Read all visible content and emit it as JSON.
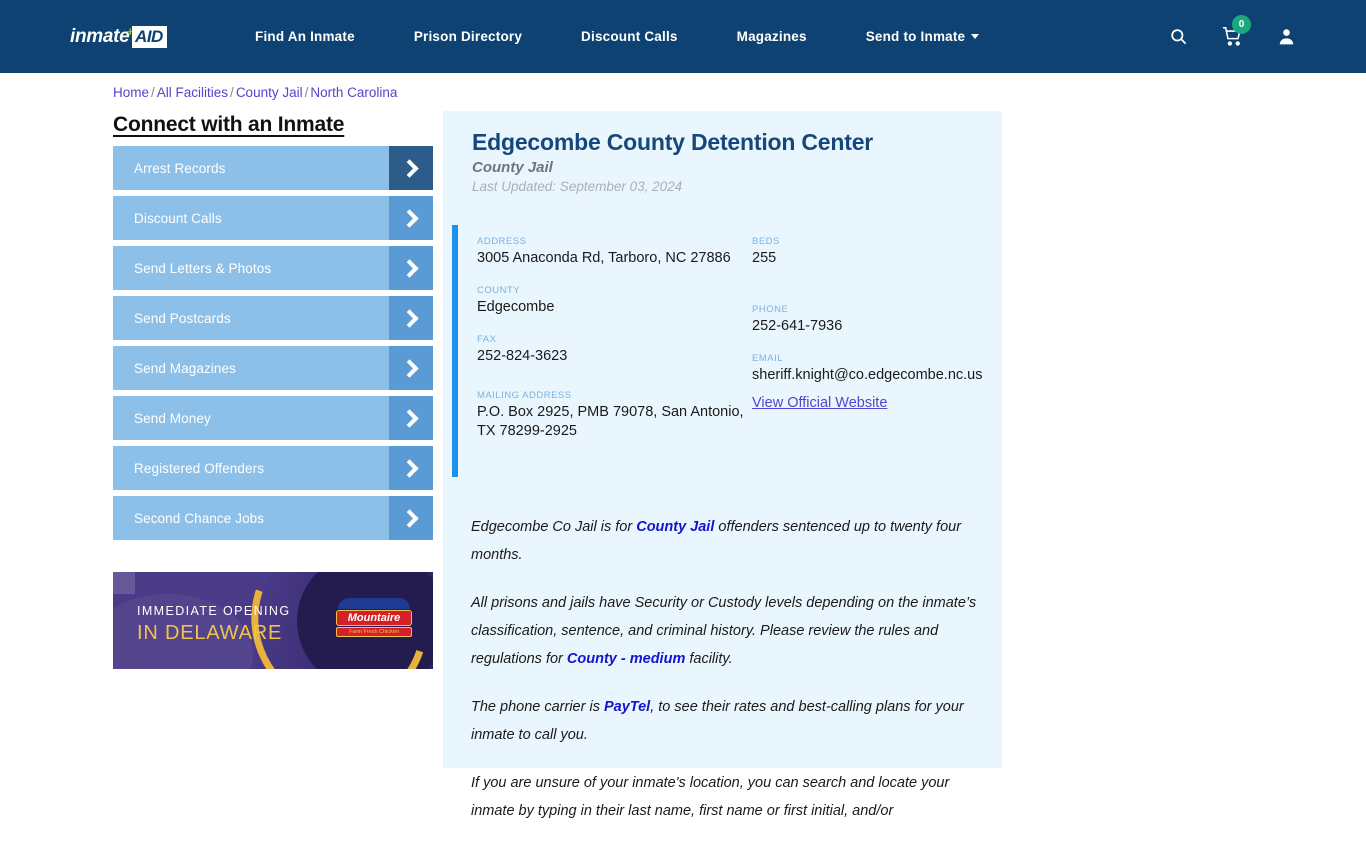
{
  "header": {
    "logo": {
      "word": "inmate",
      "cross": "+",
      "aid": "AID"
    },
    "nav": [
      {
        "label": "Find An Inmate",
        "dropdown": false
      },
      {
        "label": "Prison Directory",
        "dropdown": false
      },
      {
        "label": "Discount Calls",
        "dropdown": false
      },
      {
        "label": "Magazines",
        "dropdown": false
      },
      {
        "label": "Send to Inmate",
        "dropdown": true
      }
    ],
    "icons": {
      "search": "search-icon",
      "cart": "cart-icon",
      "cart_count": "0",
      "account": "user-icon"
    }
  },
  "breadcrumb": [
    {
      "label": "Home"
    },
    {
      "label": "All Facilities"
    },
    {
      "label": "County Jail"
    },
    {
      "label": "North Carolina"
    }
  ],
  "sidebar": {
    "title": "Connect with an Inmate",
    "items": [
      {
        "label": "Arrest Records",
        "active": true
      },
      {
        "label": "Discount Calls",
        "active": false
      },
      {
        "label": "Send Letters & Photos",
        "active": false
      },
      {
        "label": "Send Postcards",
        "active": false
      },
      {
        "label": "Send Magazines",
        "active": false
      },
      {
        "label": "Send Money",
        "active": false
      },
      {
        "label": "Registered Offenders",
        "active": false
      },
      {
        "label": "Second Chance Jobs",
        "active": false
      }
    ],
    "ad": {
      "line1": "IMMEDIATE OPENING",
      "line2": "IN DELAWARE",
      "logo_main": "Mountaire",
      "logo_sub": "Farm Fresh Chicken"
    }
  },
  "facility": {
    "name": "Edgecombe County Detention Center",
    "type": "County Jail",
    "last_updated": "Last Updated: September 03, 2024",
    "info_left": [
      {
        "label": "ADDRESS",
        "value": "3005 Anaconda Rd, Tarboro, NC 27886"
      },
      {
        "label": "COUNTY",
        "value": "Edgecombe"
      },
      {
        "label": "FAX",
        "value": "252-824-3623"
      },
      {
        "label": "MAILING ADDRESS",
        "value": "P.O. Box 2925, PMB 79078, San Antonio, TX 78299-2925"
      }
    ],
    "info_right": [
      {
        "label": "BEDS",
        "value": "255"
      },
      {
        "label": "PHONE",
        "value": "252-641-7936"
      },
      {
        "label": "EMAIL",
        "value": "sheriff.knight@co.edgecombe.nc.us"
      }
    ],
    "website_link": "View Official Website"
  },
  "body": {
    "p1_a": "Edgecombe Co Jail is for ",
    "p1_b": "County Jail",
    "p1_c": " offenders sentenced up to twenty four months.",
    "p2_a": "All prisons and jails have Security or Custody levels depending on the inmate’s classification, sentence, and criminal history. Please review the rules and regulations for ",
    "p2_b": "County - medium",
    "p2_c": " facility.",
    "p3_a": "The phone carrier is ",
    "p3_b": "PayTel",
    "p3_c": ", to see their rates and best-calling plans for your inmate to call you.",
    "p4": "If you are unsure of your inmate's location, you can search and locate your inmate by typing in their last name, first name or first initial, and/or"
  },
  "colors": {
    "header_bg": "#0e4272",
    "card_bg": "#eaf6fd",
    "accent": "#1e90e8",
    "sidebar_item": "#8dc0e8",
    "sidebar_arrow": "#5b9bd5",
    "sidebar_arrow_active": "#2e5c8a",
    "link": "#5544cc",
    "title": "#16477c",
    "badge_green": "#19a97c"
  }
}
